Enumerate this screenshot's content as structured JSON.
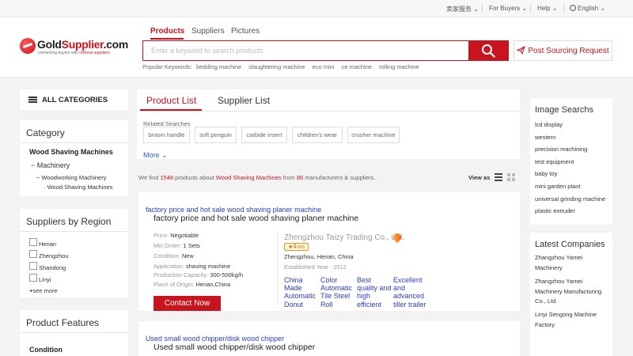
{
  "topbar": {
    "cn_service": "卖家服务",
    "for_buyers": "For Buyers",
    "help": "Help",
    "language": "English"
  },
  "logo": {
    "brand_a": "Gold",
    "brand_b": "Supplier",
    "brand_c": ".com",
    "tagline_a": "connecting buyers with ",
    "tagline_b": "chinese suppliers"
  },
  "search": {
    "tabs": [
      "Products",
      "Suppliers",
      "Pictures"
    ],
    "placeholder": "Enter a keyword to search products",
    "popular_label": "Popular Keywords:",
    "popular": [
      "bedding machine",
      "slaughtering machine",
      "eco mini",
      "ce machine",
      "rolling machine"
    ],
    "post_label": "Post Sourcing Request"
  },
  "sidebar": {
    "all_categories": "ALL CATEGORIES",
    "category_title": "Category",
    "category_current": "Wood Shaving Machines",
    "category_tree": [
      "Machinery",
      "Woodworking Machinery",
      "Wood Shaving Machines"
    ],
    "regions_title": "Suppliers by Region",
    "regions": [
      "Henan",
      "Zhengzhou",
      "Shandong",
      "Linyi"
    ],
    "see_more": "see more",
    "features_title": "Product Features",
    "condition": "Condition"
  },
  "main": {
    "tabs": [
      "Product List",
      "Supplier List"
    ],
    "related_label": "Related Searches",
    "related": [
      "broom handle",
      "soft penguin",
      "carbide insert",
      "children's wear",
      "crusher machine"
    ],
    "more": "More",
    "result": {
      "pre": "We find ",
      "count": "1548",
      "mid1": " products about ",
      "keyword": "Wood Shaving Machines",
      "mid2": " from ",
      "manufacturers": "86",
      "post": " manufacturers & suppliers."
    },
    "view_as": "View as"
  },
  "products": [
    {
      "link_title": "factory price and hot sale wood shaving planer machine",
      "title": "factory price and hot sale wood shaving planer machine",
      "specs": [
        {
          "label": "Price: ",
          "value": "Negotiable"
        },
        {
          "label": "Min.Order: ",
          "value": "1 Sets"
        },
        {
          "label": "Condition: ",
          "value": "New"
        },
        {
          "label": "Application: ",
          "value": "shaving machine"
        },
        {
          "label": "Production Capacity: ",
          "value": "300-500kg/h"
        },
        {
          "label": "Place of Origin: ",
          "value": "Henan,China"
        }
      ],
      "contact": "Contact Now",
      "supplier": "Zhengzhou Taizy Trading Co., Ltd.",
      "years": "4",
      "years_unit": "YRS",
      "location": "Zhengzhou, Henan, China",
      "established": "Established Year : 2012",
      "links": [
        "China Made Automatic Donut",
        "Color Automatic Tile Steel Roll",
        "Best quality and high efficient",
        "Excellent and advanced tiller trailer"
      ]
    },
    {
      "link_title": "Used small wood chipper/disk wood chipper",
      "title": "Used small wood chipper/disk wood chipper"
    }
  ],
  "right": {
    "image_searches_title": "Image Searchs",
    "image_searches": [
      "lcd display",
      "western",
      "precision machining",
      "test equipment",
      "baby toy",
      "mini garden plant",
      "universal grinding machine",
      "plastic extruder"
    ],
    "latest_title": "Latest Companies",
    "latest": [
      "Zhangzhou Yamei Machinery",
      "Zhangzhou Yamei Machinery Manufacturing Co., Ltd.",
      "Linyi Sengong Machine Factory"
    ]
  },
  "colors": {
    "accent": "#c8141e",
    "link": "#2a3fc0"
  }
}
